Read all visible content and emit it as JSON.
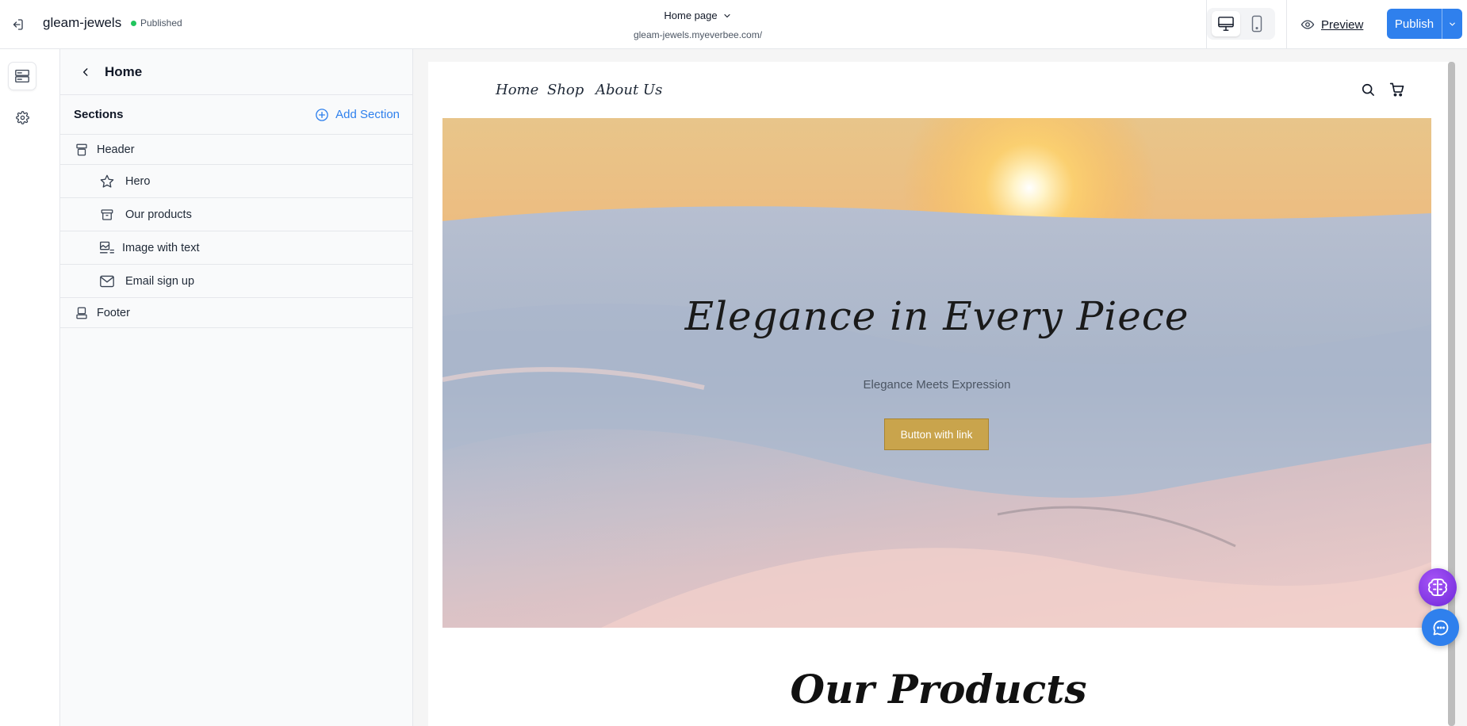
{
  "topbar": {
    "site_name": "gleam-jewels",
    "status": "Published",
    "page_select": "Home page",
    "page_url": "gleam-jewels.myeverbee.com/",
    "preview_label": "Preview",
    "publish_label": "Publish"
  },
  "panel": {
    "title": "Home",
    "sections_label": "Sections",
    "add_section_label": "Add Section",
    "items": [
      {
        "label": "Header",
        "icon": "header-icon",
        "level": "top"
      },
      {
        "label": "Hero",
        "icon": "star-icon",
        "level": "child"
      },
      {
        "label": "Our products",
        "icon": "archive-icon",
        "level": "child"
      },
      {
        "label": "Image with text",
        "icon": "image-text-icon",
        "level": "child"
      },
      {
        "label": "Email sign up",
        "icon": "envelope-icon",
        "level": "child"
      },
      {
        "label": "Footer",
        "icon": "footer-icon",
        "level": "top"
      }
    ]
  },
  "store": {
    "nav": [
      "Home",
      "Shop",
      "About Us"
    ],
    "hero_title": "Elegance in Every Piece",
    "hero_subtitle": "Elegance Meets Expression",
    "hero_button": "Button with link",
    "products_title": "Our Products"
  },
  "colors": {
    "accent": "#2f80ed",
    "hero_button": "#c9a44c",
    "status_dot": "#22c55e"
  }
}
